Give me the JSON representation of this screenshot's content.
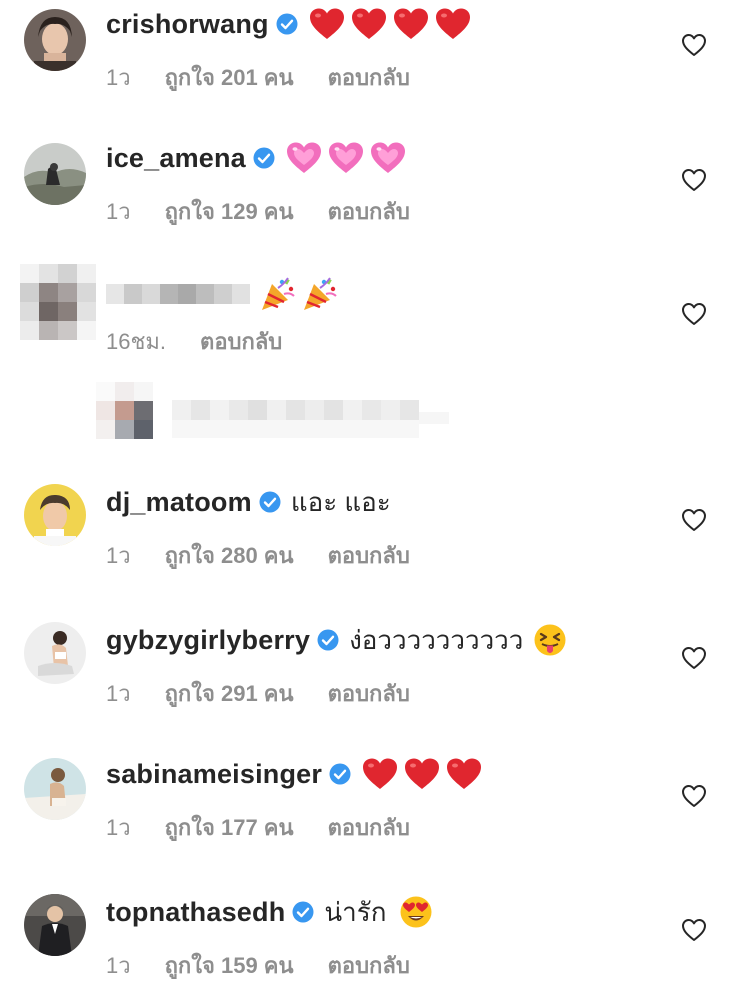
{
  "comments": [
    {
      "username": "crishorwang",
      "verified": true,
      "text": "",
      "emoji": [
        "heart-red",
        "heart-red",
        "heart-red",
        "heart-red"
      ],
      "time": "1ว",
      "likes": "ถูกใจ 201 คน",
      "reply": "ตอบกลับ"
    },
    {
      "username": "ice_amena",
      "verified": true,
      "text": "",
      "emoji": [
        "heart-pink",
        "heart-pink",
        "heart-pink"
      ],
      "time": "1ว",
      "likes": "ถูกใจ 129 คน",
      "reply": "ตอบกลับ"
    },
    {
      "username": "",
      "verified": false,
      "text": "",
      "emoji": [
        "party-popper",
        "party-popper"
      ],
      "time": "16ชม.",
      "likes": "",
      "reply": "ตอบกลับ"
    },
    {
      "username": "dj_matoom",
      "verified": true,
      "text": "แอะ แอะ",
      "emoji": [],
      "time": "1ว",
      "likes": "ถูกใจ 280 คน",
      "reply": "ตอบกลับ"
    },
    {
      "username": "gybzygirlyberry",
      "verified": true,
      "text": "ง่อวววววววววว",
      "emoji": [
        "tongue-squint-face"
      ],
      "time": "1ว",
      "likes": "ถูกใจ 291 คน",
      "reply": "ตอบกลับ"
    },
    {
      "username": "sabinameisinger",
      "verified": true,
      "text": "",
      "emoji": [
        "heart-red",
        "heart-red",
        "heart-red"
      ],
      "time": "1ว",
      "likes": "ถูกใจ 177 คน",
      "reply": "ตอบกลับ"
    },
    {
      "username": "topnathasedh",
      "verified": true,
      "text": "น่ารัก",
      "emoji": [
        "heart-eyes-face"
      ],
      "time": "1ว",
      "likes": "ถูกใจ 159 คน",
      "reply": "ตอบกลับ"
    }
  ],
  "colors": {
    "text": "#262626",
    "meta": "#8e8e8e",
    "verified": "#3897f0",
    "heart_red": "#e0262f",
    "heart_pink": "#f26ebd"
  },
  "icons": {
    "like": "heart-outline-icon",
    "verified": "verified-badge-icon"
  }
}
